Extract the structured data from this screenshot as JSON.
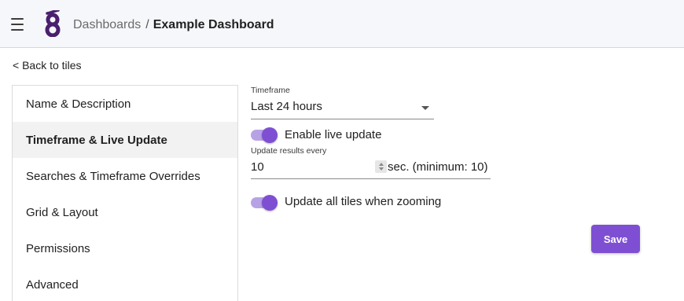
{
  "header": {
    "menu_icon": "hamburger-menu-icon",
    "logo": "brand-logo",
    "breadcrumb_parent": "Dashboards",
    "breadcrumb_separator": "/",
    "breadcrumb_current": "Example Dashboard"
  },
  "back_link": "< Back to tiles",
  "sidebar": {
    "items": [
      {
        "label": "Name & Description"
      },
      {
        "label": "Timeframe & Live Update",
        "active": true
      },
      {
        "label": "Searches & Timeframe Overrides"
      },
      {
        "label": "Grid & Layout"
      },
      {
        "label": "Permissions"
      },
      {
        "label": "Advanced"
      }
    ]
  },
  "form": {
    "timeframe": {
      "label": "Timeframe",
      "value": "Last 24 hours"
    },
    "live_update": {
      "label": "Enable live update",
      "enabled": true
    },
    "update_interval": {
      "label": "Update results every",
      "value": "10",
      "suffix": "sec. (minimum: 10)"
    },
    "zoom_update": {
      "label": "Update all tiles when zooming",
      "enabled": true
    },
    "save_label": "Save"
  },
  "colors": {
    "accent": "#7e4fd3",
    "accent_light": "#b8a2e6",
    "header_bg": "#f6f7fa",
    "active_nav_bg": "#f2f2f2"
  }
}
